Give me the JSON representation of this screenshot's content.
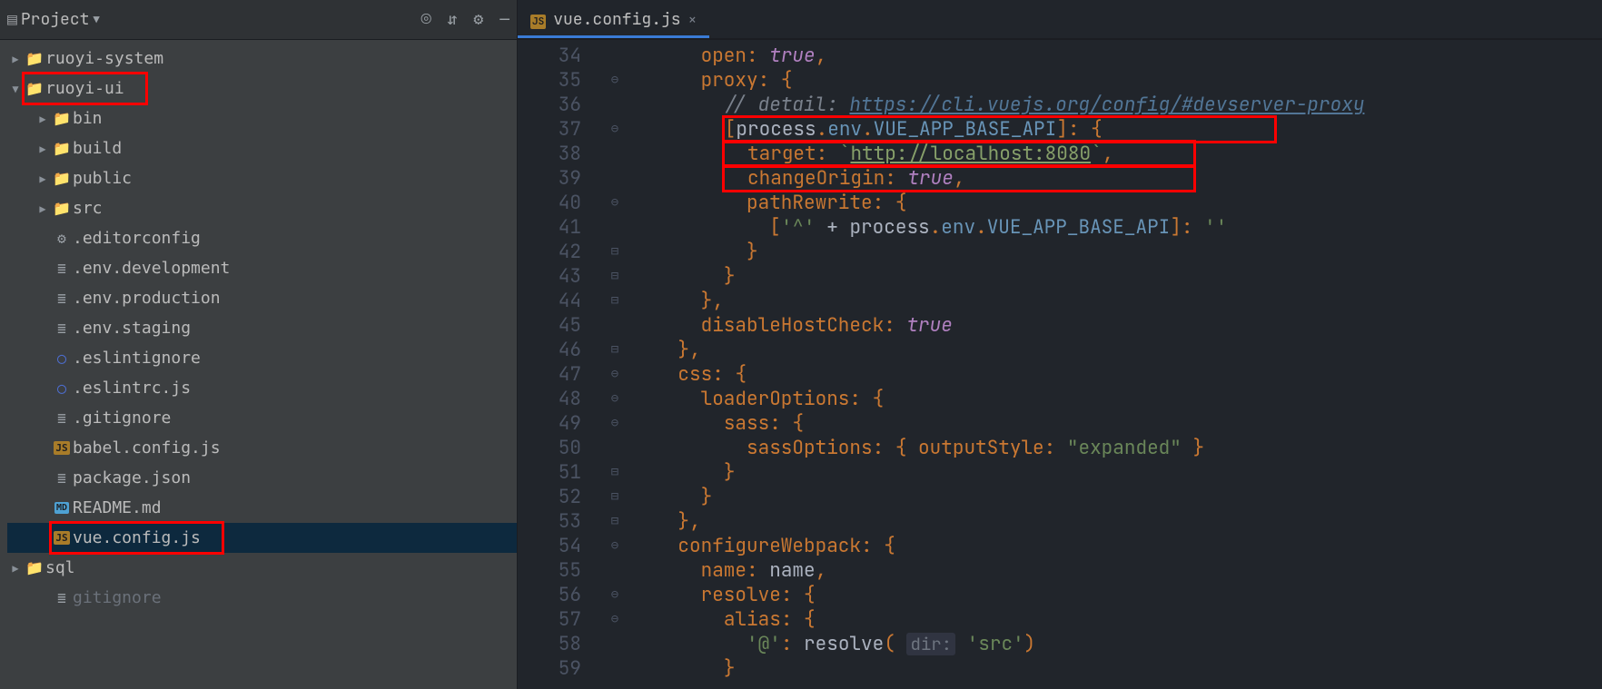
{
  "sidebar": {
    "title": "Project",
    "tree": [
      {
        "d": 0,
        "arrow": "▶",
        "icon": "folder",
        "label": "ruoyi-system"
      },
      {
        "d": 0,
        "arrow": "▼",
        "icon": "folder",
        "label": "ruoyi-ui",
        "red": true
      },
      {
        "d": 1,
        "arrow": "▶",
        "icon": "folder",
        "label": "bin"
      },
      {
        "d": 1,
        "arrow": "▶",
        "icon": "folder",
        "label": "build"
      },
      {
        "d": 1,
        "arrow": "▶",
        "icon": "folder",
        "label": "public"
      },
      {
        "d": 1,
        "arrow": "▶",
        "icon": "folder",
        "label": "src"
      },
      {
        "d": 1,
        "arrow": "",
        "icon": "gear",
        "label": ".editorconfig"
      },
      {
        "d": 1,
        "arrow": "",
        "icon": "txt",
        "label": ".env.development"
      },
      {
        "d": 1,
        "arrow": "",
        "icon": "txt",
        "label": ".env.production"
      },
      {
        "d": 1,
        "arrow": "",
        "icon": "txt",
        "label": ".env.staging"
      },
      {
        "d": 1,
        "arrow": "",
        "icon": "circle",
        "label": ".eslintignore"
      },
      {
        "d": 1,
        "arrow": "",
        "icon": "circle",
        "label": ".eslintrc.js"
      },
      {
        "d": 1,
        "arrow": "",
        "icon": "txt",
        "label": ".gitignore"
      },
      {
        "d": 1,
        "arrow": "",
        "icon": "js",
        "label": "babel.config.js"
      },
      {
        "d": 1,
        "arrow": "",
        "icon": "txt",
        "label": "package.json"
      },
      {
        "d": 1,
        "arrow": "",
        "icon": "md",
        "label": "README.md"
      },
      {
        "d": 1,
        "arrow": "",
        "icon": "js",
        "label": "vue.config.js",
        "red": true,
        "sel": true
      },
      {
        "d": 0,
        "arrow": "▶",
        "icon": "folder",
        "label": "sql"
      },
      {
        "d": 1,
        "arrow": "",
        "icon": "txt",
        "label": "gitignore",
        "dimmed": true
      }
    ],
    "icons": {
      "target": "◎",
      "collapse": "⇵",
      "gear": "⚙",
      "min": "—"
    }
  },
  "tab": {
    "name": "vue.config.js"
  },
  "code": {
    "start": 34,
    "lines": [
      {
        "n": 34,
        "html": "      <span class='c-prop'>open</span><span class='c-punc'>:</span> <span class='c-key c-ital'>true</span><span class='c-punc'>,</span>"
      },
      {
        "n": 35,
        "html": "      <span class='c-prop'>proxy</span><span class='c-punc'>:</span> <span class='c-punc'>{</span>",
        "g": "⊖"
      },
      {
        "n": 36,
        "html": "        <span class='c-cmt'>// detail: </span><span class='c-link'>https://cli.vuejs.org/config/#devserver-proxy</span>"
      },
      {
        "n": 37,
        "html": "        <span class='redspan'><span class='c-punc'>[</span><span class='c-white'>process</span><span class='c-punc'>.</span><span class='c-expr'>env</span><span class='c-punc'>.</span><span class='c-expr'>VUE_APP_BASE_API</span><span class='c-punc'>]:</span> <span class='c-punc'>{</span>               </span>",
        "g": "⊖"
      },
      {
        "n": 38,
        "html": "        <span class='redspan'>  <span class='c-prop'>target</span><span class='c-punc'>:</span> <span class='c-str2'>`</span><span class='c-link2'>http://localhost:8080</span><span class='c-str2'>`</span><span class='c-punc'>,</span>       </span>"
      },
      {
        "n": 39,
        "html": "        <span class='redspan'>  <span class='c-prop'>changeOrigin</span><span class='c-punc'>:</span> <span class='c-key c-ital'>true</span><span class='c-punc'>,</span>                    </span>"
      },
      {
        "n": 40,
        "html": "          <span class='c-prop'>pathRewrite</span><span class='c-punc'>:</span> <span class='c-punc'>{</span>",
        "g": "⊖"
      },
      {
        "n": 41,
        "html": "            <span class='c-punc'>[</span><span class='c-str2'>'^'</span> <span class='c-white'>+</span> <span class='c-white'>process</span><span class='c-punc'>.</span><span class='c-expr'>env</span><span class='c-punc'>.</span><span class='c-expr'>VUE_APP_BASE_API</span><span class='c-punc'>]:</span> <span class='c-str2'>''</span>"
      },
      {
        "n": 42,
        "html": "          <span class='c-punc'>}</span>",
        "g": "⊟"
      },
      {
        "n": 43,
        "html": "        <span class='c-punc'>}</span>",
        "g": "⊟"
      },
      {
        "n": 44,
        "html": "      <span class='c-punc'>},</span>",
        "g": "⊟"
      },
      {
        "n": 45,
        "html": "      <span class='c-prop'>disableHostCheck</span><span class='c-punc'>:</span> <span class='c-key c-ital'>true</span>"
      },
      {
        "n": 46,
        "html": "    <span class='c-punc'>},</span>",
        "g": "⊟"
      },
      {
        "n": 47,
        "html": "    <span class='c-prop'>css</span><span class='c-punc'>:</span> <span class='c-punc'>{</span>",
        "g": "⊖"
      },
      {
        "n": 48,
        "html": "      <span class='c-prop'>loaderOptions</span><span class='c-punc'>:</span> <span class='c-punc'>{</span>",
        "g": "⊖"
      },
      {
        "n": 49,
        "html": "        <span class='c-prop'>sass</span><span class='c-punc'>:</span> <span class='c-punc'>{</span>",
        "g": "⊖"
      },
      {
        "n": 50,
        "html": "          <span class='c-prop'>sassOptions</span><span class='c-punc'>:</span> <span class='c-punc'>{</span> <span class='c-prop'>outputStyle</span><span class='c-punc'>:</span> <span class='c-str2'>\"expanded\"</span> <span class='c-punc'>}</span>"
      },
      {
        "n": 51,
        "html": "        <span class='c-punc'>}</span>",
        "g": "⊟"
      },
      {
        "n": 52,
        "html": "      <span class='c-punc'>}</span>",
        "g": "⊟"
      },
      {
        "n": 53,
        "html": "    <span class='c-punc'>},</span>",
        "g": "⊟"
      },
      {
        "n": 54,
        "html": "    <span class='c-prop'>configureWebpack</span><span class='c-punc'>:</span> <span class='c-punc'>{</span>",
        "g": "⊖"
      },
      {
        "n": 55,
        "html": "      <span class='c-prop'>name</span><span class='c-punc'>:</span> <span class='c-white'>name</span><span class='c-punc'>,</span>"
      },
      {
        "n": 56,
        "html": "      <span class='c-prop'>resolve</span><span class='c-punc'>:</span> <span class='c-punc'>{</span>",
        "g": "⊖"
      },
      {
        "n": 57,
        "html": "        <span class='c-prop'>alias</span><span class='c-punc'>:</span> <span class='c-punc'>{</span>",
        "g": "⊖"
      },
      {
        "n": 58,
        "html": "          <span class='c-str2'>'@'</span><span class='c-punc'>:</span> <span class='c-white'>resolve</span><span class='c-punc'>(</span> <span class='hint'>dir:</span> <span class='c-str2'>'src'</span><span class='c-punc'>)</span>"
      },
      {
        "n": 59,
        "html": "        <span class='c-punc'>}</span>"
      }
    ]
  }
}
